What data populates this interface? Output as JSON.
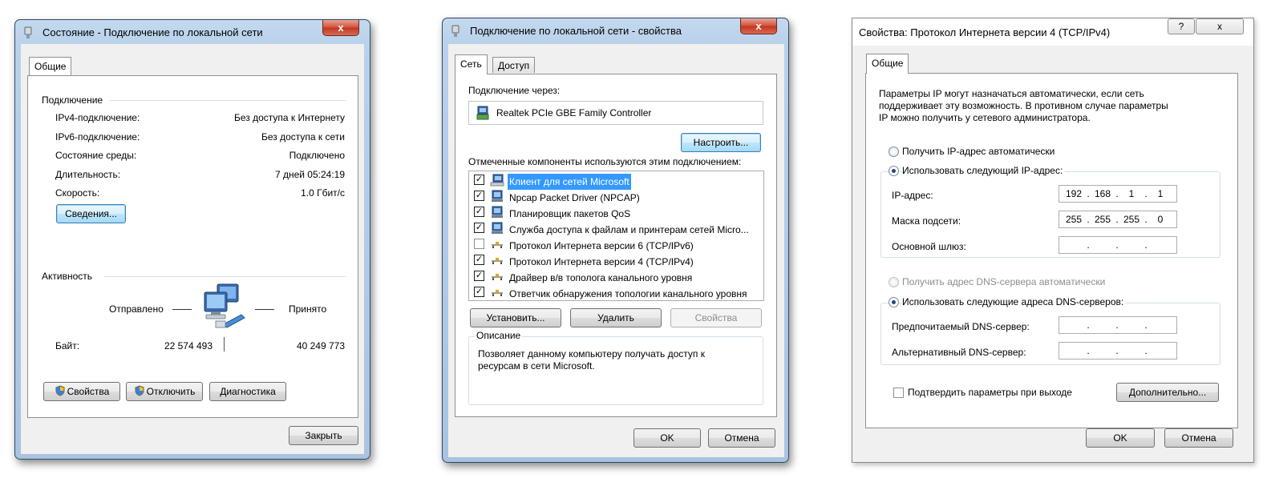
{
  "status_dialog": {
    "title": "Состояние - Подключение по локальной сети",
    "close_glyph": "x",
    "tab_general": "Общие",
    "connection_group": "Подключение",
    "rows": [
      {
        "label": "IPv4-подключение:",
        "value": "Без доступа к Интернету"
      },
      {
        "label": "IPv6-подключение:",
        "value": "Без доступа к сети"
      },
      {
        "label": "Состояние среды:",
        "value": "Подключено"
      },
      {
        "label": "Длительность:",
        "value": "7 дней 05:24:19"
      },
      {
        "label": "Скорость:",
        "value": "1.0 Гбит/с"
      }
    ],
    "details_button": "Сведения...",
    "activity_group": "Активность",
    "sent_label": "Отправлено",
    "received_label": "Принято",
    "bytes_label": "Байт:",
    "bytes_sent": "22 574 493",
    "bytes_received": "40 249 773",
    "properties_button": "Свойства",
    "disable_button": "Отключить",
    "diagnose_button": "Диагностика",
    "close_button": "Закрыть"
  },
  "props_dialog": {
    "title": "Подключение по локальной сети - свойства",
    "close_glyph": "x",
    "tab_network": "Сеть",
    "tab_access": "Доступ",
    "connect_using_label": "Подключение через:",
    "adapter_name": "Realtek PCIe GBE Family Controller",
    "configure_button": "Настроить...",
    "components_label": "Отмеченные компоненты используются этим подключением:",
    "components": [
      {
        "label": "Клиент для сетей Microsoft",
        "checked": true,
        "icon": "network-client-icon",
        "selected": true
      },
      {
        "label": "Npcap Packet Driver (NPCAP)",
        "checked": true,
        "icon": "network-service-icon",
        "selected": false
      },
      {
        "label": "Планировщик пакетов QoS",
        "checked": true,
        "icon": "network-service-icon",
        "selected": false
      },
      {
        "label": "Служба доступа к файлам и принтерам сетей Micro...",
        "checked": true,
        "icon": "network-service-icon",
        "selected": false
      },
      {
        "label": "Протокол Интернета версии 6 (TCP/IPv6)",
        "checked": false,
        "icon": "protocol-icon",
        "selected": false
      },
      {
        "label": "Протокол Интернета версии 4 (TCP/IPv4)",
        "checked": true,
        "icon": "protocol-icon",
        "selected": false
      },
      {
        "label": "Драйвер в/в тополога канального уровня",
        "checked": true,
        "icon": "protocol-icon",
        "selected": false
      },
      {
        "label": "Ответчик обнаружения топологии канального уровня",
        "checked": true,
        "icon": "protocol-icon",
        "selected": false
      }
    ],
    "install_button": "Установить...",
    "uninstall_button": "Удалить",
    "properties_button": "Свойства",
    "description_group": "Описание",
    "description_text_1": "Позволяет данному компьютеру получать доступ к",
    "description_text_2": "ресурсам в сети Microsoft.",
    "ok_button": "OK",
    "cancel_button": "Отмена"
  },
  "ipv4_dialog": {
    "title": "Свойства: Протокол Интернета версии 4 (TCP/IPv4)",
    "help_glyph": "?",
    "close_glyph": "x",
    "tab_general": "Общие",
    "intro_1": "Параметры IP могут назначаться автоматически, если сеть",
    "intro_2": "поддерживает эту возможность. В противном случае параметры",
    "intro_3": "IP можно получить у сетевого администратора.",
    "radio_auto_ip": "Получить IP-адрес автоматически",
    "radio_manual_ip": "Использовать следующий IP-адрес:",
    "ip_label": "IP-адрес:",
    "ip_octets": [
      "192",
      "168",
      "1",
      "1"
    ],
    "mask_label": "Маска подсети:",
    "mask_octets": [
      "255",
      "255",
      "255",
      "0"
    ],
    "gateway_label": "Основной шлюз:",
    "radio_auto_dns": "Получить адрес DNS-сервера автоматически",
    "radio_manual_dns": "Использовать следующие адреса DNS-серверов:",
    "dns_pref_label": "Предпочитаемый DNS-сервер:",
    "dns_alt_label": "Альтернативный DNS-сервер:",
    "dot": ".",
    "validate_label": "Подтвердить параметры при выходе",
    "advanced_button": "Дополнительно...",
    "ok_button": "OK",
    "cancel_button": "Отмена"
  }
}
